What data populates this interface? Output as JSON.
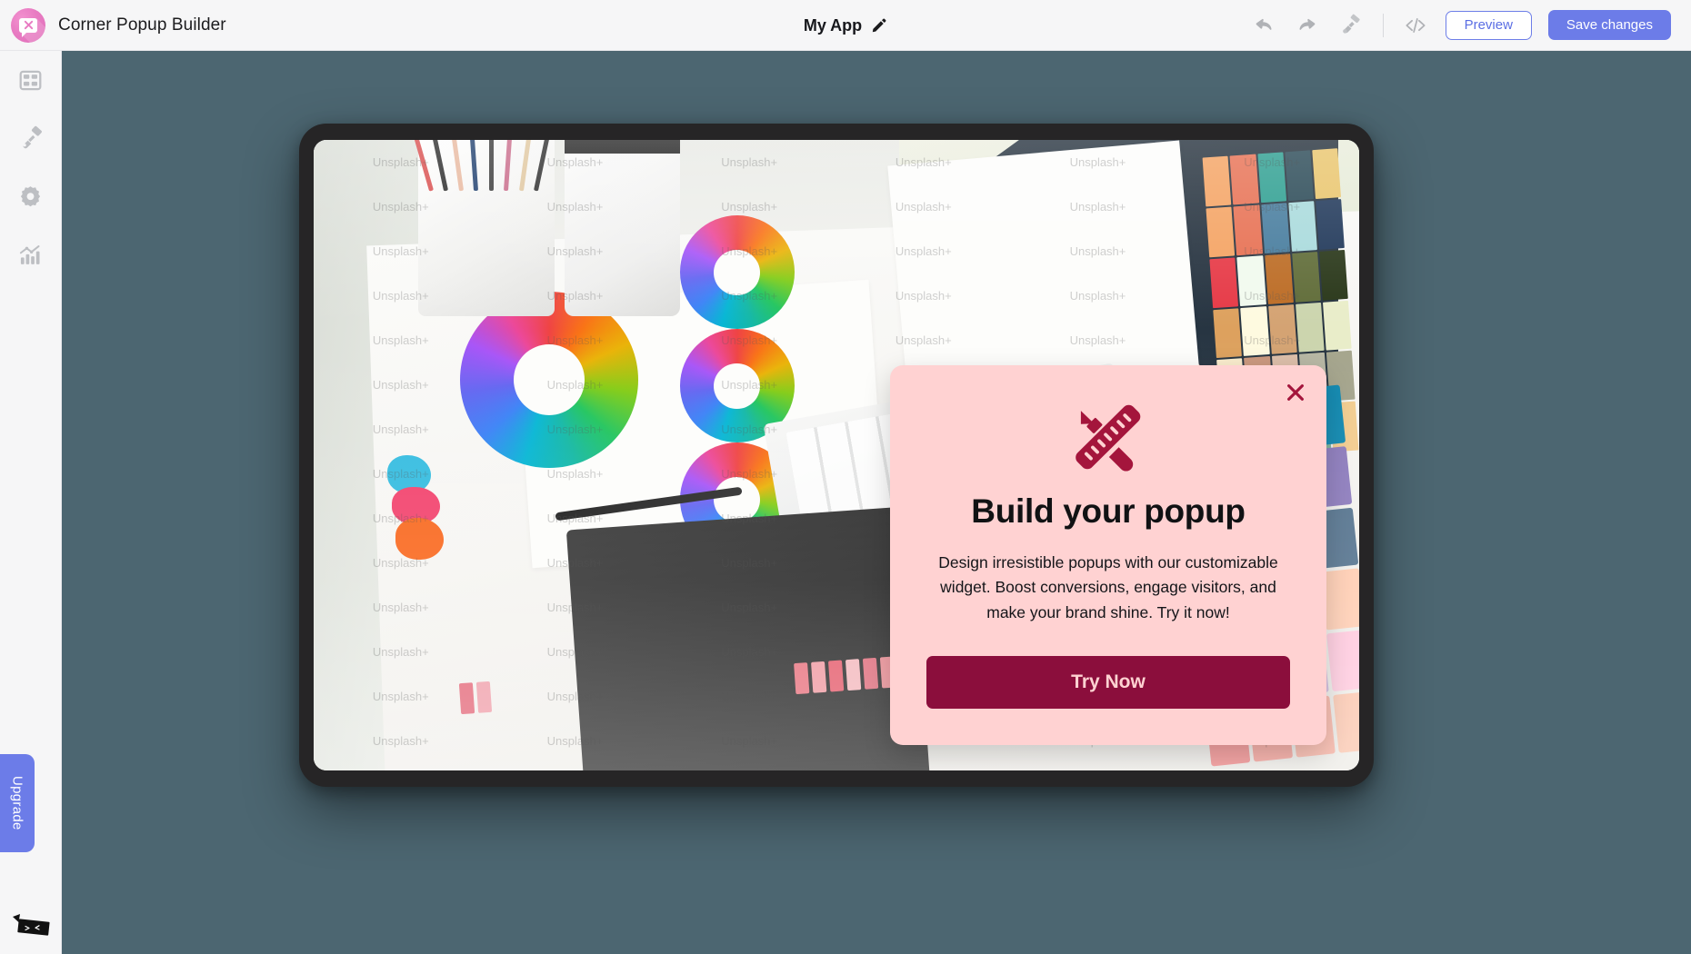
{
  "header": {
    "brand_name": "Corner Popup Builder",
    "brand_logo_icon": "popup-bubble-logo",
    "doc_title": "My App",
    "doc_title_edit_icon": "pencil-edit-icon",
    "undo_icon": "undo-arrow-icon",
    "redo_icon": "redo-arrow-icon",
    "theme_icon": "paint-roller-icon",
    "code_icon": "code-brackets-icon",
    "preview_label": "Preview",
    "save_label": "Save changes",
    "accent_color": "#6c7ce8",
    "bar_background": "#f6f6f7"
  },
  "sidebar": {
    "items": [
      {
        "name": "templates",
        "icon": "layout-grid-icon"
      },
      {
        "name": "design",
        "icon": "paint-brush-icon"
      },
      {
        "name": "settings",
        "icon": "gear-icon"
      },
      {
        "name": "analytics",
        "icon": "bar-chart-icon"
      }
    ],
    "upgrade_label": "Upgrade",
    "badge_icon": "brand-tag-icon"
  },
  "canvas": {
    "background_color": "#4c6671",
    "device_frame_color": "#262526",
    "preview_image_alt": "Designer desk with color wheels, swatches, graphics tablet and hands typing on a keyboard",
    "watermark_text": "Unsplash+"
  },
  "popup": {
    "background_color": "#ffd2d2",
    "icon": "pencil-ruler-design-icon",
    "icon_color": "#a4153c",
    "title": "Build your popup",
    "body": "Design irresistible popups with our customizable widget. Boost conversions, engage visitors, and make your brand shine. Try it now!",
    "cta_label": "Try Now",
    "cta_background": "#8b0e3c",
    "cta_text_color": "#ffd2d2",
    "close_icon": "close-x-icon",
    "close_icon_color": "#a4153c"
  }
}
